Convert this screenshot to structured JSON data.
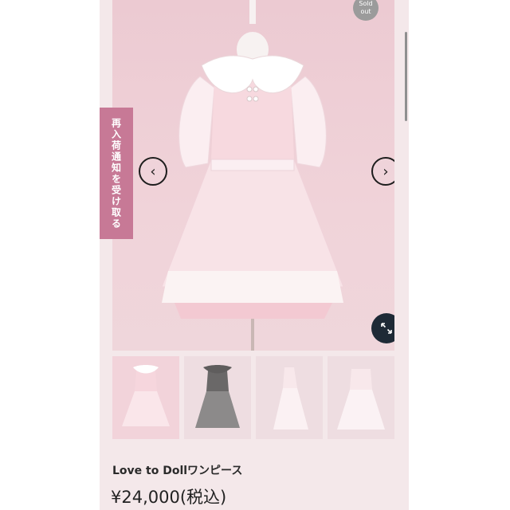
{
  "badge": {
    "line1": "Sold",
    "line2": "out"
  },
  "restock_tab": {
    "label": "再入荷通知を受け取る"
  },
  "nav": {
    "prev_icon": "chevron-left-icon",
    "next_icon": "chevron-right-icon",
    "zoom_icon": "expand-icon"
  },
  "product": {
    "title": "Love to Dollワンピース",
    "price": "¥24,000(税込)"
  },
  "colors": {
    "restock_tab": "#c77996",
    "zoom_button": "#1e2a36",
    "badge": "#9b9b9b"
  }
}
